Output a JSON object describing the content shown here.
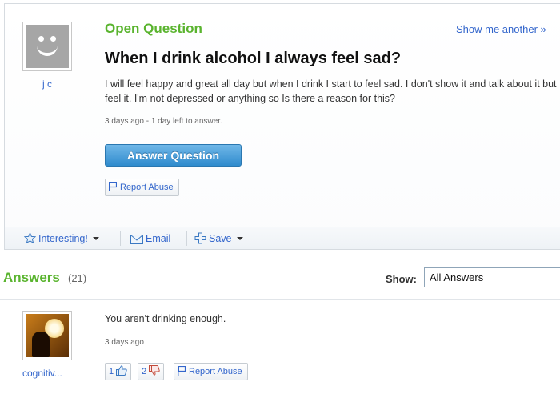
{
  "question": {
    "status": "Open Question",
    "show_another": "Show me another »",
    "title": "When I drink alcohol I always feel sad?",
    "body": "I will feel happy and great all day but when I drink I start to feel sad. I don't show it and talk about it but I feel it. I'm not depressed or anything so Is there a reason for this?",
    "meta": "3 days ago - 1 day left to answer.",
    "answer_button": "Answer Question",
    "report_abuse": "Report Abuse",
    "asker": "j c",
    "avatar_icon": "smiley-face-icon"
  },
  "actions": {
    "interesting": "Interesting!",
    "email": "Email",
    "save": "Save"
  },
  "answers_section": {
    "heading": "Answers",
    "count": "(21)",
    "show_label": "Show:",
    "show_selected": "All Answers"
  },
  "answers": [
    {
      "text": "You aren't drinking enough.",
      "meta": "3 days ago",
      "user": "cognitiv...",
      "thumbs_up": "1",
      "thumbs_down": "2",
      "report_abuse": "Report Abuse"
    }
  ],
  "colors": {
    "accent_green": "#5ab42f",
    "link_blue": "#3366cc",
    "button_blue": "#2f8bcd"
  }
}
